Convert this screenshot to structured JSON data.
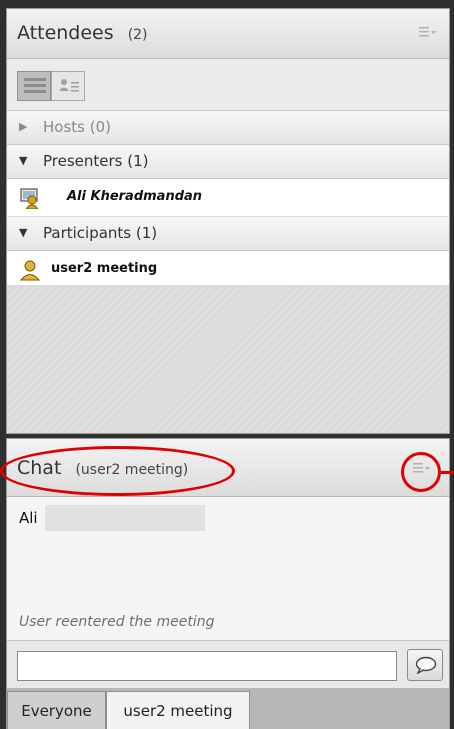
{
  "attendees": {
    "title": "Attendees",
    "count": "(2)",
    "sections": {
      "hosts": {
        "label": "Hosts (0)",
        "arrow": "▶"
      },
      "presenters": {
        "label": "Presenters (1)",
        "arrow": "▼"
      },
      "participants": {
        "label": "Participants (1)",
        "arrow": "▼"
      }
    },
    "presenter_name": "Ali Kheradmandan",
    "participant_name": "user2 meeting"
  },
  "chat": {
    "title": "Chat",
    "subtitle": "(user2 meeting)",
    "message_sender": "Ali",
    "system_message": "User reentered the meeting",
    "input_value": "",
    "tabs": {
      "everyone": "Everyone",
      "user2": "user2 meeting"
    }
  },
  "icons": {
    "pod_menu": "menu-icon",
    "list_view": "list-view-icon",
    "detail_view": "detail-view-icon",
    "presenter": "presenter-icon",
    "participant": "participant-icon",
    "send": "speech-bubble-icon"
  },
  "colors": {
    "annotation": "#e00000",
    "presenter_icon": "#d9a520",
    "participant_icon": "#e3b23c"
  }
}
